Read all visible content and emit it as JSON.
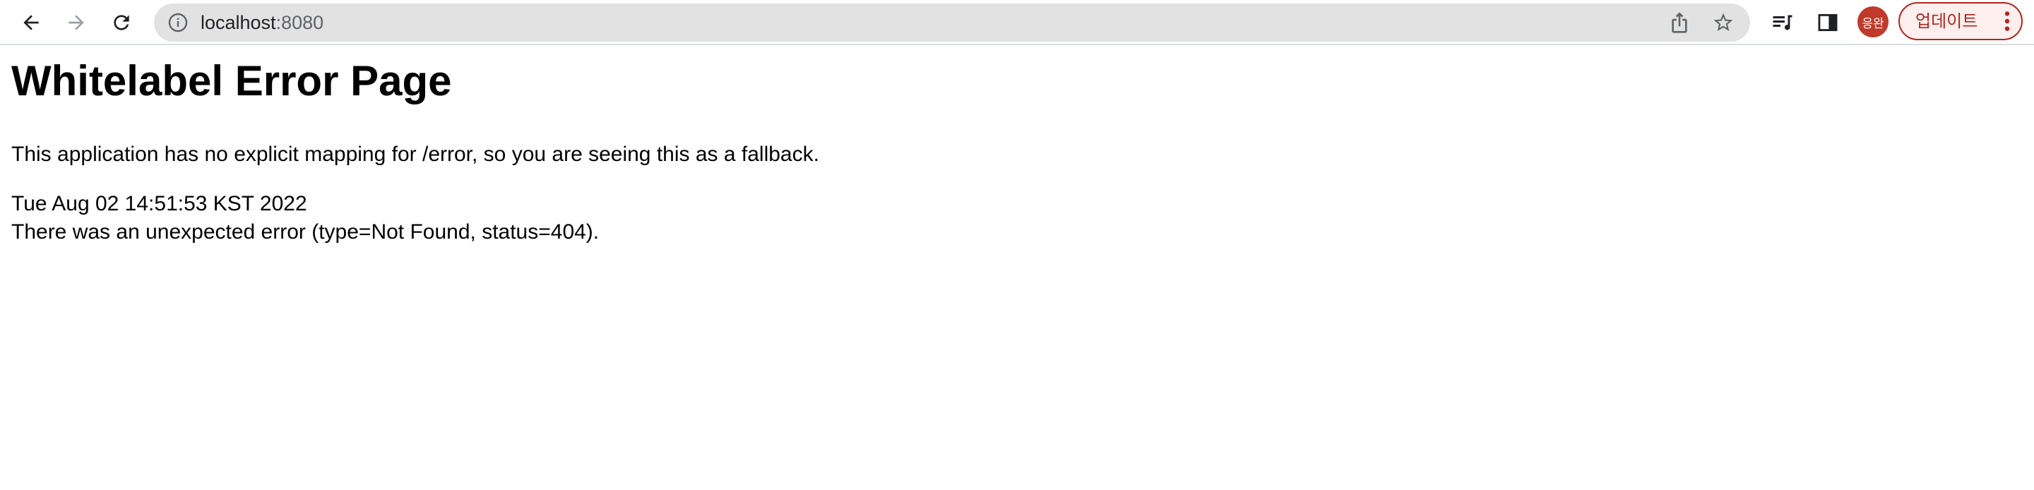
{
  "browser": {
    "url_host": "localhost",
    "url_port": ":8080",
    "profile_avatar_text": "응완",
    "update_button_label": "업데이트",
    "colors": {
      "toolbar_bg": "#ffffff",
      "omnibox_bg": "#e2e2e2",
      "avatar_bg": "#c0392b",
      "update_accent": "#b3261e"
    },
    "icons": {
      "back": "arrow-left-icon",
      "forward": "arrow-right-icon",
      "reload": "reload-icon",
      "site_info": "info-icon",
      "share": "share-icon",
      "bookmark": "star-icon",
      "reading_list": "reading-list-icon",
      "side_panel": "side-panel-icon",
      "menu": "kebab-menu-icon"
    }
  },
  "page": {
    "title": "Whitelabel Error Page",
    "description": "This application has no explicit mapping for /error, so you are seeing this as a fallback.",
    "timestamp": "Tue Aug 02 14:51:53 KST 2022",
    "error_message": "There was an unexpected error (type=Not Found, status=404)."
  }
}
